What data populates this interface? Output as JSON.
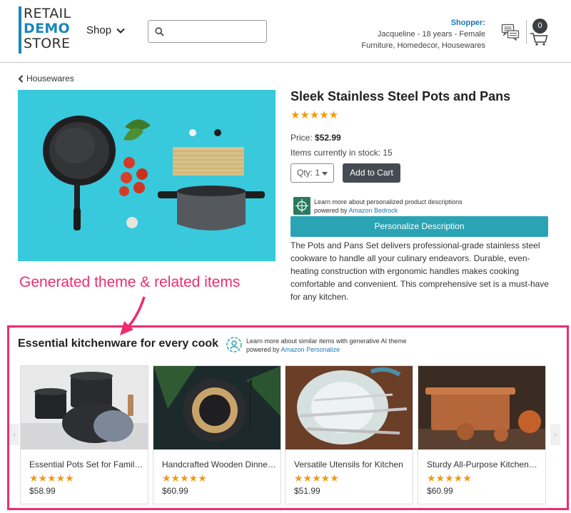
{
  "header": {
    "logo": {
      "line1": "RETAIL",
      "line2": "DEMO",
      "line3": "STORE"
    },
    "shop_label": "Shop",
    "search_placeholder": "",
    "shopper": {
      "label": "Shopper:",
      "line1": "Jacqueline - 18 years - Female",
      "line2": "Furniture, Homedecor, Housewares"
    },
    "cart_count": "0"
  },
  "breadcrumb": {
    "label": "Housewares"
  },
  "product": {
    "title": "Sleek Stainless Steel Pots and Pans",
    "stars": "★★★★★",
    "rating": 5,
    "price_label": "Price:",
    "price": "$52.99",
    "stock_text": "Items currently in stock: 15",
    "qty_label": "Qty: 1",
    "add_to_cart": "Add to Cart",
    "bedrock_note": "Learn more about personalized product descriptions",
    "bedrock_powered": "powered by",
    "bedrock_link": "Amazon Bedrock",
    "personalize_button": "Personalize Description",
    "description": "The Pots and Pans Set delivers professional-grade stainless steel cookware to handle all your culinary endeavors. Durable, even-heating construction with ergonomic handles makes cooking comfortable and convenient. This comprehensive set is a must-have for any kitchen."
  },
  "annotation": {
    "text": "Generated theme & related items"
  },
  "related": {
    "title": "Essential kitchenware for every cook",
    "note": "Learn more about similar items with generative AI theme",
    "powered": "powered by",
    "link": "Amazon Personalize",
    "prev": "‹",
    "next": "›",
    "items": [
      {
        "name": "Essential Pots Set for Families",
        "stars": "★★★★★",
        "price": "$58.99"
      },
      {
        "name": "Handcrafted Wooden Dinnerware",
        "stars": "★★★★★",
        "price": "$60.99"
      },
      {
        "name": "Versatile Utensils for Kitchen",
        "stars": "★★★★★",
        "price": "$51.99"
      },
      {
        "name": "Sturdy All-Purpose Kitchenware",
        "stars": "★★★★★",
        "price": "$60.99"
      }
    ]
  },
  "colors": {
    "accent": "#1a87b8",
    "star": "#f29a10",
    "annotation": "#ef2c6e",
    "personalize_button": "#2aa4b4",
    "add_to_cart": "#454b52"
  },
  "icons": {
    "chevron": "chevron-down-icon",
    "search": "search-icon",
    "chat": "chat-icon",
    "cart": "cart-icon",
    "back": "chevron-left-icon"
  }
}
